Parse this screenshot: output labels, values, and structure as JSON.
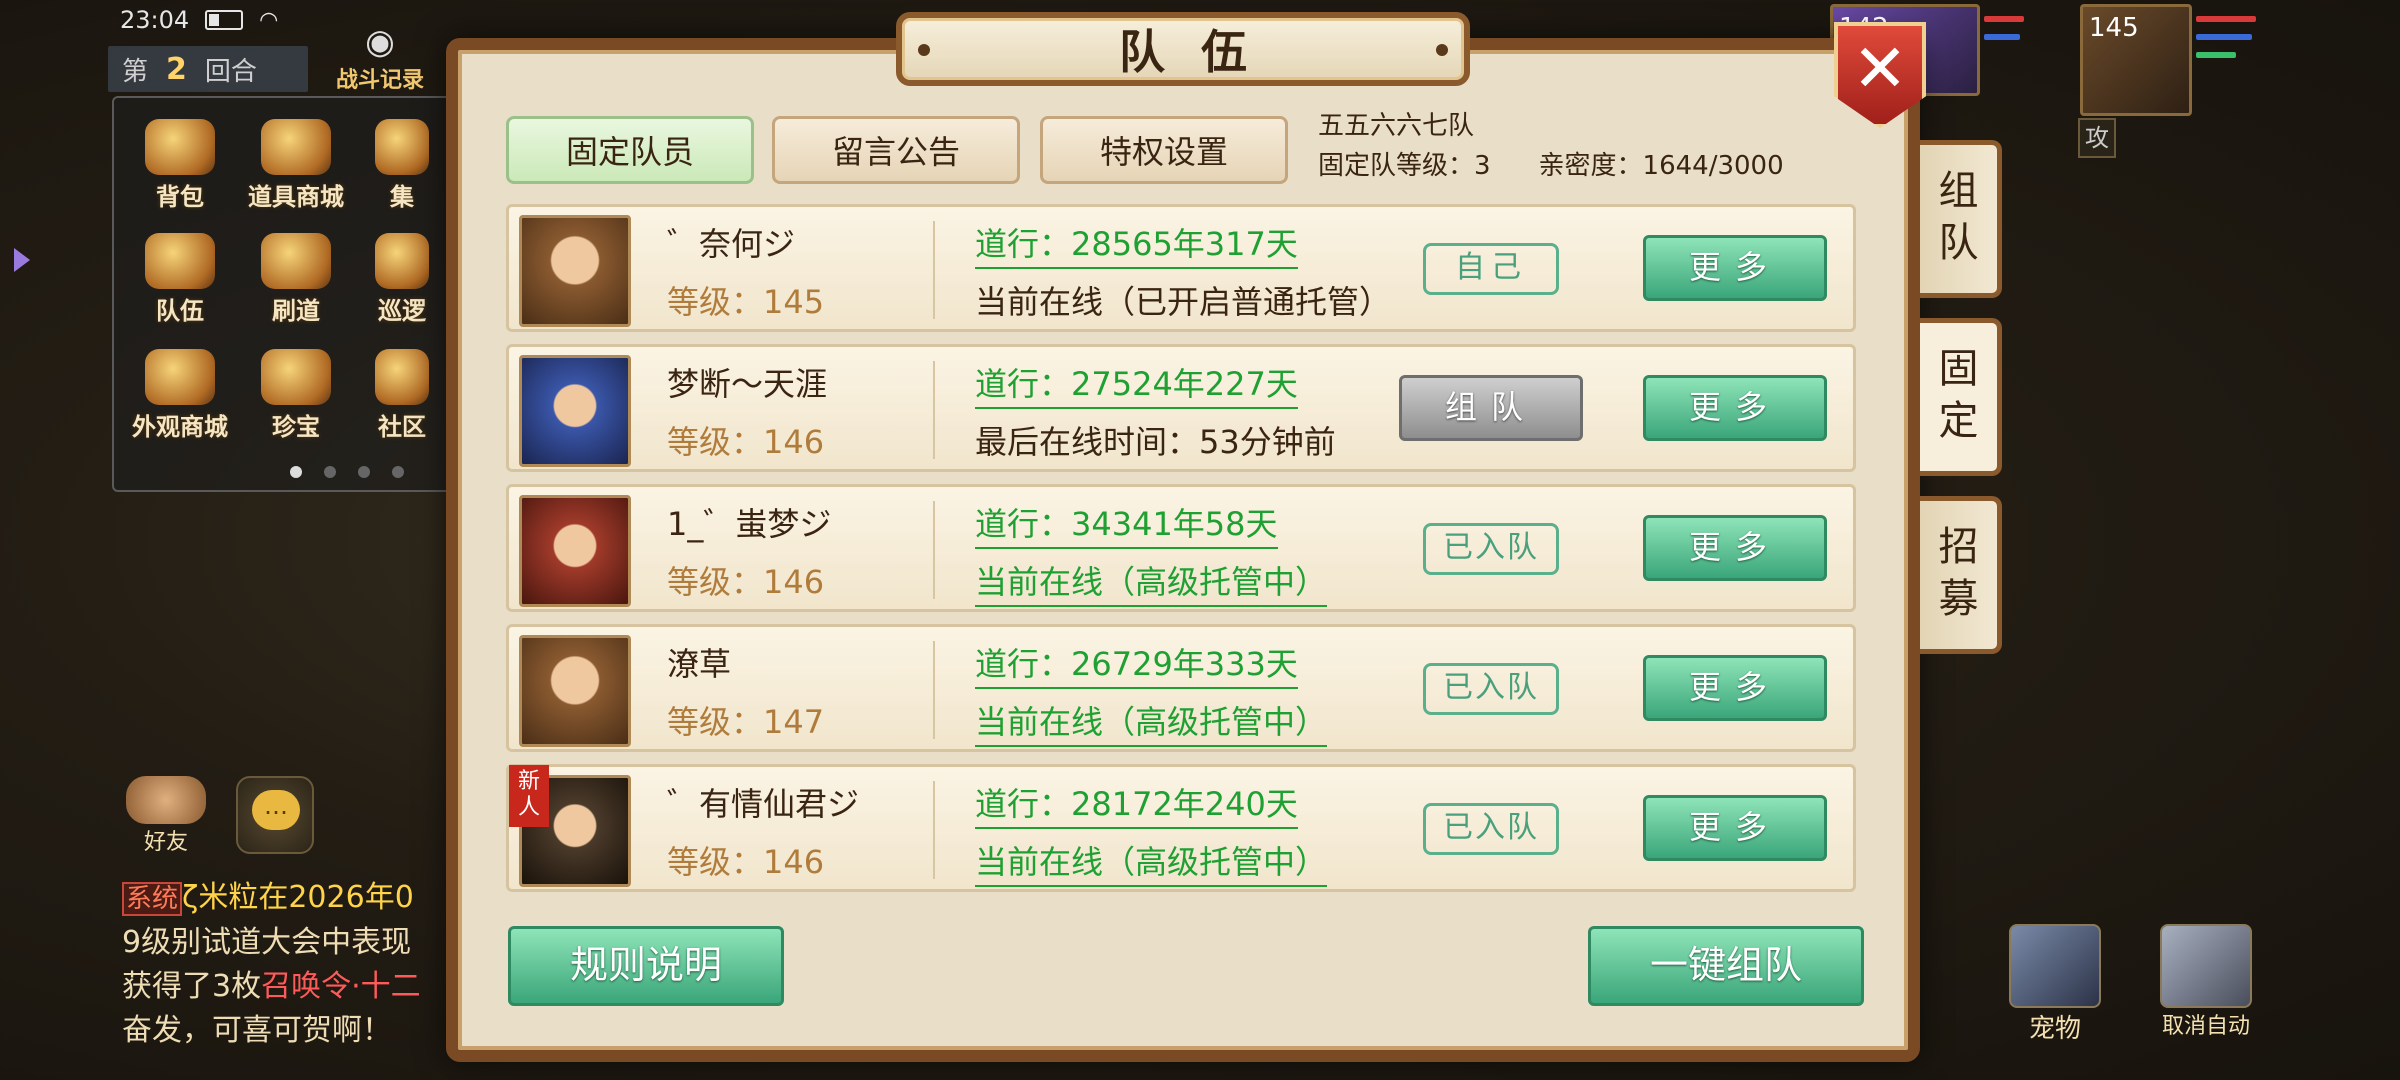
{
  "status_bar": {
    "time": "23:04"
  },
  "hud": {
    "round_prefix": "第",
    "round_number": "2",
    "round_suffix": "回合",
    "battle_log": "战斗记录",
    "menu": [
      {
        "label": "背包",
        "icon": "bag-icon"
      },
      {
        "label": "道具商城",
        "icon": "gold-ingot-icon"
      },
      {
        "label": "集",
        "icon": "gourd-icon"
      },
      {
        "label": "队伍",
        "icon": "team-flag-icon"
      },
      {
        "label": "刷道",
        "icon": "scroll-icon"
      },
      {
        "label": "巡逻",
        "icon": "patrol-icon"
      },
      {
        "label": "外观商城",
        "icon": "pavilion-icon"
      },
      {
        "label": "珍宝",
        "icon": "treasure-icon"
      },
      {
        "label": "社区",
        "icon": "community-icon"
      }
    ],
    "friends_label": "好友",
    "system_tag": "系统",
    "system_msg": {
      "line1_name": "ζ米粒",
      "line1_rest": "在2026年0",
      "line2": "9级别试道大会中表现",
      "line3_pre": "获得了3枚",
      "line3_item": "召唤令·十二",
      "line4": "奋发，可喜可贺啊！"
    },
    "ally_level_1": "142",
    "ally_level_2": "145",
    "ally_action": "攻",
    "skill_buttons": [
      {
        "label": "宠物",
        "icon": "pet-icon"
      },
      {
        "label": "取消自动",
        "icon": "cancel-auto-icon"
      }
    ]
  },
  "dialog": {
    "title": "队伍",
    "tabs": [
      {
        "label": "固定队员",
        "active": true
      },
      {
        "label": "留言公告",
        "active": false
      },
      {
        "label": "特权设置",
        "active": false
      }
    ],
    "team_name": "五五六六七队",
    "team_level_label": "固定队等级：3",
    "intimacy_label": "亲密度：1644/3000",
    "members": [
      {
        "name": "゛奈何ジ",
        "level": "等级：145",
        "dao": "道行：28565年317天",
        "status": "当前在线（已开启普通托管）",
        "status_green": false,
        "action": "自己",
        "action_type": "stamp",
        "more": "更多",
        "is_new": false,
        "avatar_color": "#8a5a30"
      },
      {
        "name": "梦断～天涯",
        "level": "等级：146",
        "dao": "道行：27524年227天",
        "status": "最后在线时间：53分钟前",
        "status_green": false,
        "action": "组队",
        "action_type": "button",
        "more": "更多",
        "is_new": false,
        "avatar_color": "#3a56a8"
      },
      {
        "name": "1_゛蚩梦ジ",
        "level": "等级：146",
        "dao": "道行：34341年58天",
        "status": "当前在线（高级托管中）",
        "status_green": true,
        "action": "已入队",
        "action_type": "stamp",
        "more": "更多",
        "is_new": false,
        "avatar_color": "#a03a2a"
      },
      {
        "name": "潦草",
        "level": "等级：147",
        "dao": "道行：26729年333天",
        "status": "当前在线（高级托管中）",
        "status_green": true,
        "action": "已入队",
        "action_type": "stamp",
        "more": "更多",
        "is_new": false,
        "avatar_color": "#8a5a30"
      },
      {
        "name": "゛有情仙君ジ",
        "level": "等级：146",
        "dao": "道行：28172年240天",
        "status": "当前在线（高级托管中）",
        "status_green": true,
        "action": "已入队",
        "action_type": "stamp",
        "more": "更多",
        "is_new": true,
        "new_label": "新人",
        "avatar_color": "#4a3a2a"
      }
    ],
    "rules_button": "规则说明",
    "auto_team_button": "一键组队",
    "side_tabs": [
      {
        "label": "组队",
        "active": false
      },
      {
        "label": "固定",
        "active": true
      },
      {
        "label": "招募",
        "active": false
      }
    ]
  },
  "colors": {
    "frame": "#7a4a24",
    "parchment": "#e9dfc8",
    "green_text": "#1ea032",
    "level_text": "#b07c3c",
    "green_button": "#3aa67a",
    "close_red": "#c8281c"
  }
}
